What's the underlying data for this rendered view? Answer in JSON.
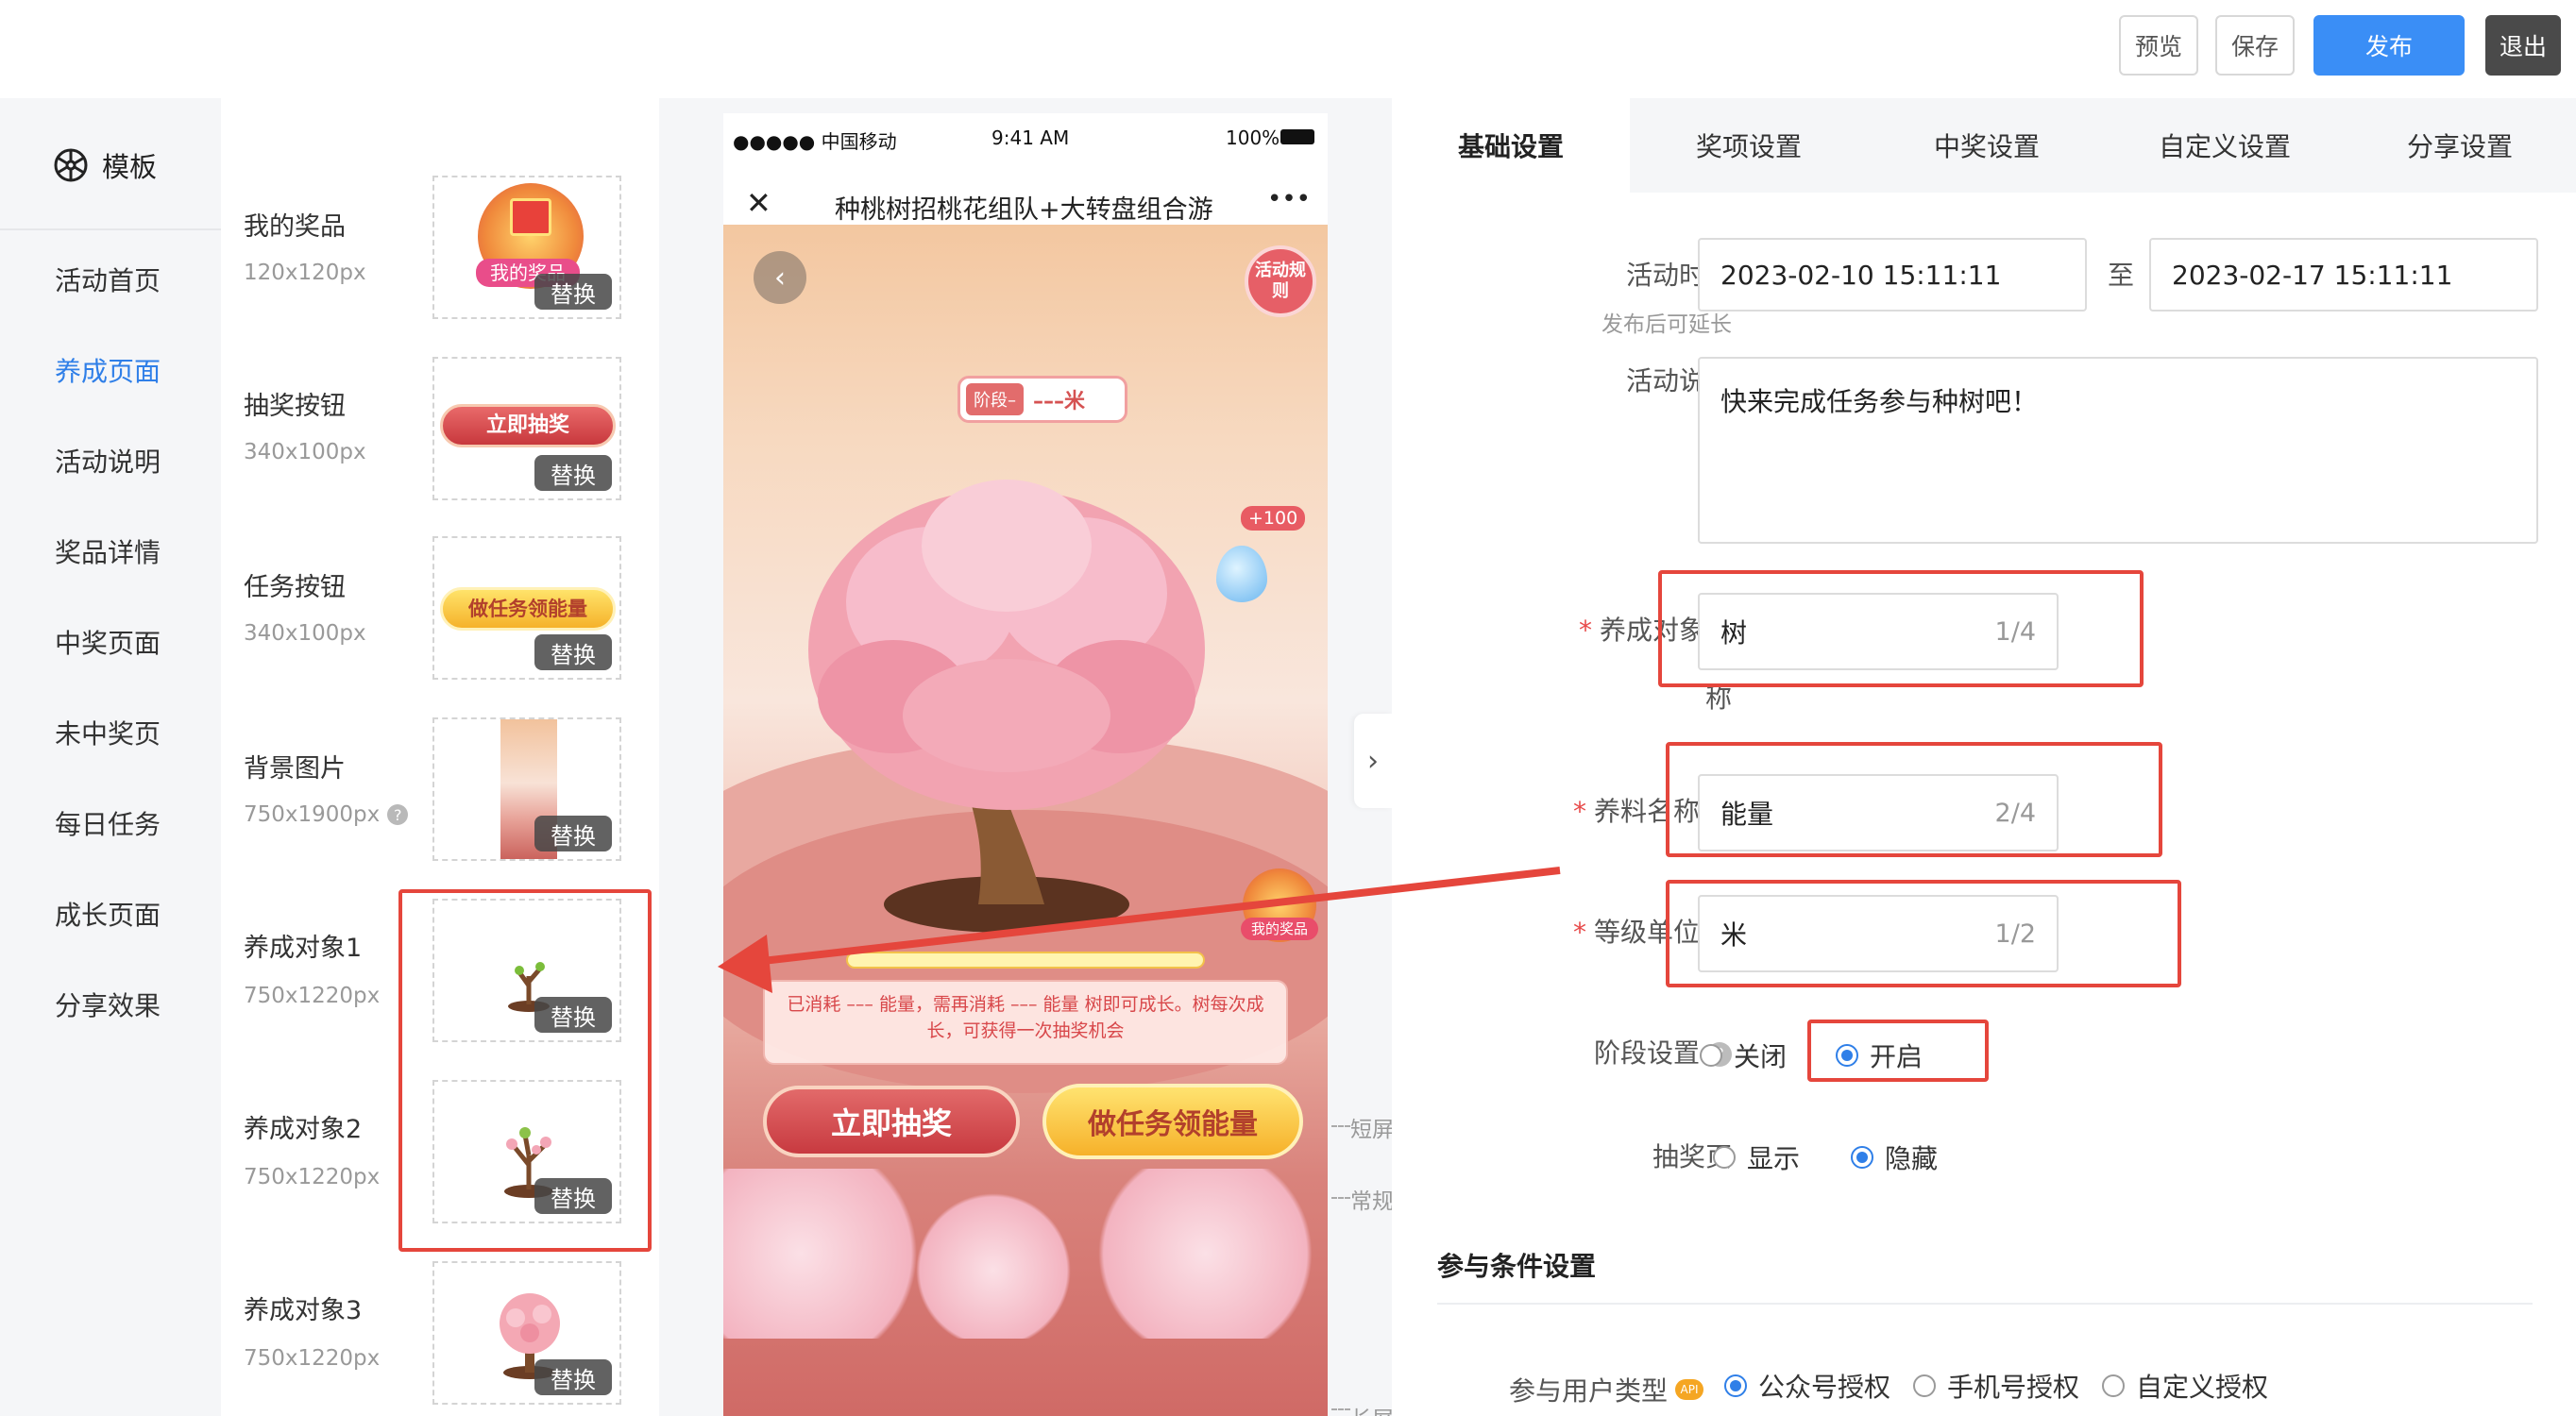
{
  "toolbar": {
    "preview": "预览",
    "save": "保存",
    "publish": "发布",
    "exit": "退出"
  },
  "colors": {
    "primary": "#3a8ef6",
    "highlight": "#e5463c",
    "required": "#e84a4a"
  },
  "leftnav": {
    "header": "模板",
    "items": [
      "活动首页",
      "养成页面",
      "活动说明",
      "奖品详情",
      "中奖页面",
      "未中奖页",
      "每日任务",
      "成长页面",
      "分享效果"
    ],
    "active_index": 1
  },
  "assets": {
    "replace_label": "替换",
    "items": [
      {
        "title": "我的奖品",
        "size": "120x120px",
        "badge": "我的奖品"
      },
      {
        "title": "抽奖按钮",
        "size": "340x100px",
        "badge": "立即抽奖"
      },
      {
        "title": "任务按钮",
        "size": "340x100px",
        "badge": "做任务领能量"
      },
      {
        "title": "背景图片",
        "size": "750x1900px",
        "badge": ""
      },
      {
        "title": "养成对象1",
        "size": "750x1220px",
        "badge": ""
      },
      {
        "title": "养成对象2",
        "size": "750x1220px",
        "badge": ""
      },
      {
        "title": "养成对象3",
        "size": "750x1220px",
        "badge": ""
      }
    ]
  },
  "phone": {
    "carrier": "●●●●● 中国移动",
    "time": "9:41 AM",
    "battery": "100%",
    "title": "种桃树招桃花组队+大转盘组合游",
    "close": "✕",
    "more": "•••",
    "stage_label": "阶段–",
    "stage_value": "–––米",
    "activity_rules": "活动规则",
    "plus_energy": "+100",
    "my_prize": "我的奖品",
    "message": "已消耗 ––– 能量，需再消耗 ––– 能量 树即可成长。树每次成长，可获得一次抽奖机会",
    "draw_button": "立即抽奖",
    "task_button": "做任务领能量",
    "guide_short": "短屏",
    "guide_normal": "常规",
    "guide_long": "长屏"
  },
  "settings": {
    "tabs": [
      "基础设置",
      "奖项设置",
      "中奖设置",
      "自定义设置",
      "分享设置"
    ],
    "active_tab": 0,
    "activity_time_label": "活动时间",
    "activity_time_hint": "发布后可延长",
    "start_time": "2023-02-10 15:11:11",
    "to": "至",
    "end_time": "2023-02-17 15:11:11",
    "desc_label": "活动说明",
    "desc_value": "快来完成任务参与种树吧！",
    "object_name_label_1": "养成对象名",
    "object_name_label_2": "称",
    "object_name_value": "树",
    "object_name_count": "1/4",
    "feed_label": "养料名称",
    "feed_value": "能量",
    "feed_count": "2/4",
    "unit_label": "等级单位",
    "unit_value": "米",
    "unit_count": "1/2",
    "stage_label": "阶段设置",
    "stage_off": "关闭",
    "stage_on": "开启",
    "draw_page_label": "抽奖页",
    "draw_show": "显示",
    "draw_hide": "隐藏",
    "participation_title": "参与条件设置",
    "user_type_label": "参与用户类型",
    "user_type_badge": "API",
    "user_types": [
      "公众号授权",
      "手机号授权",
      "自定义授权"
    ]
  }
}
